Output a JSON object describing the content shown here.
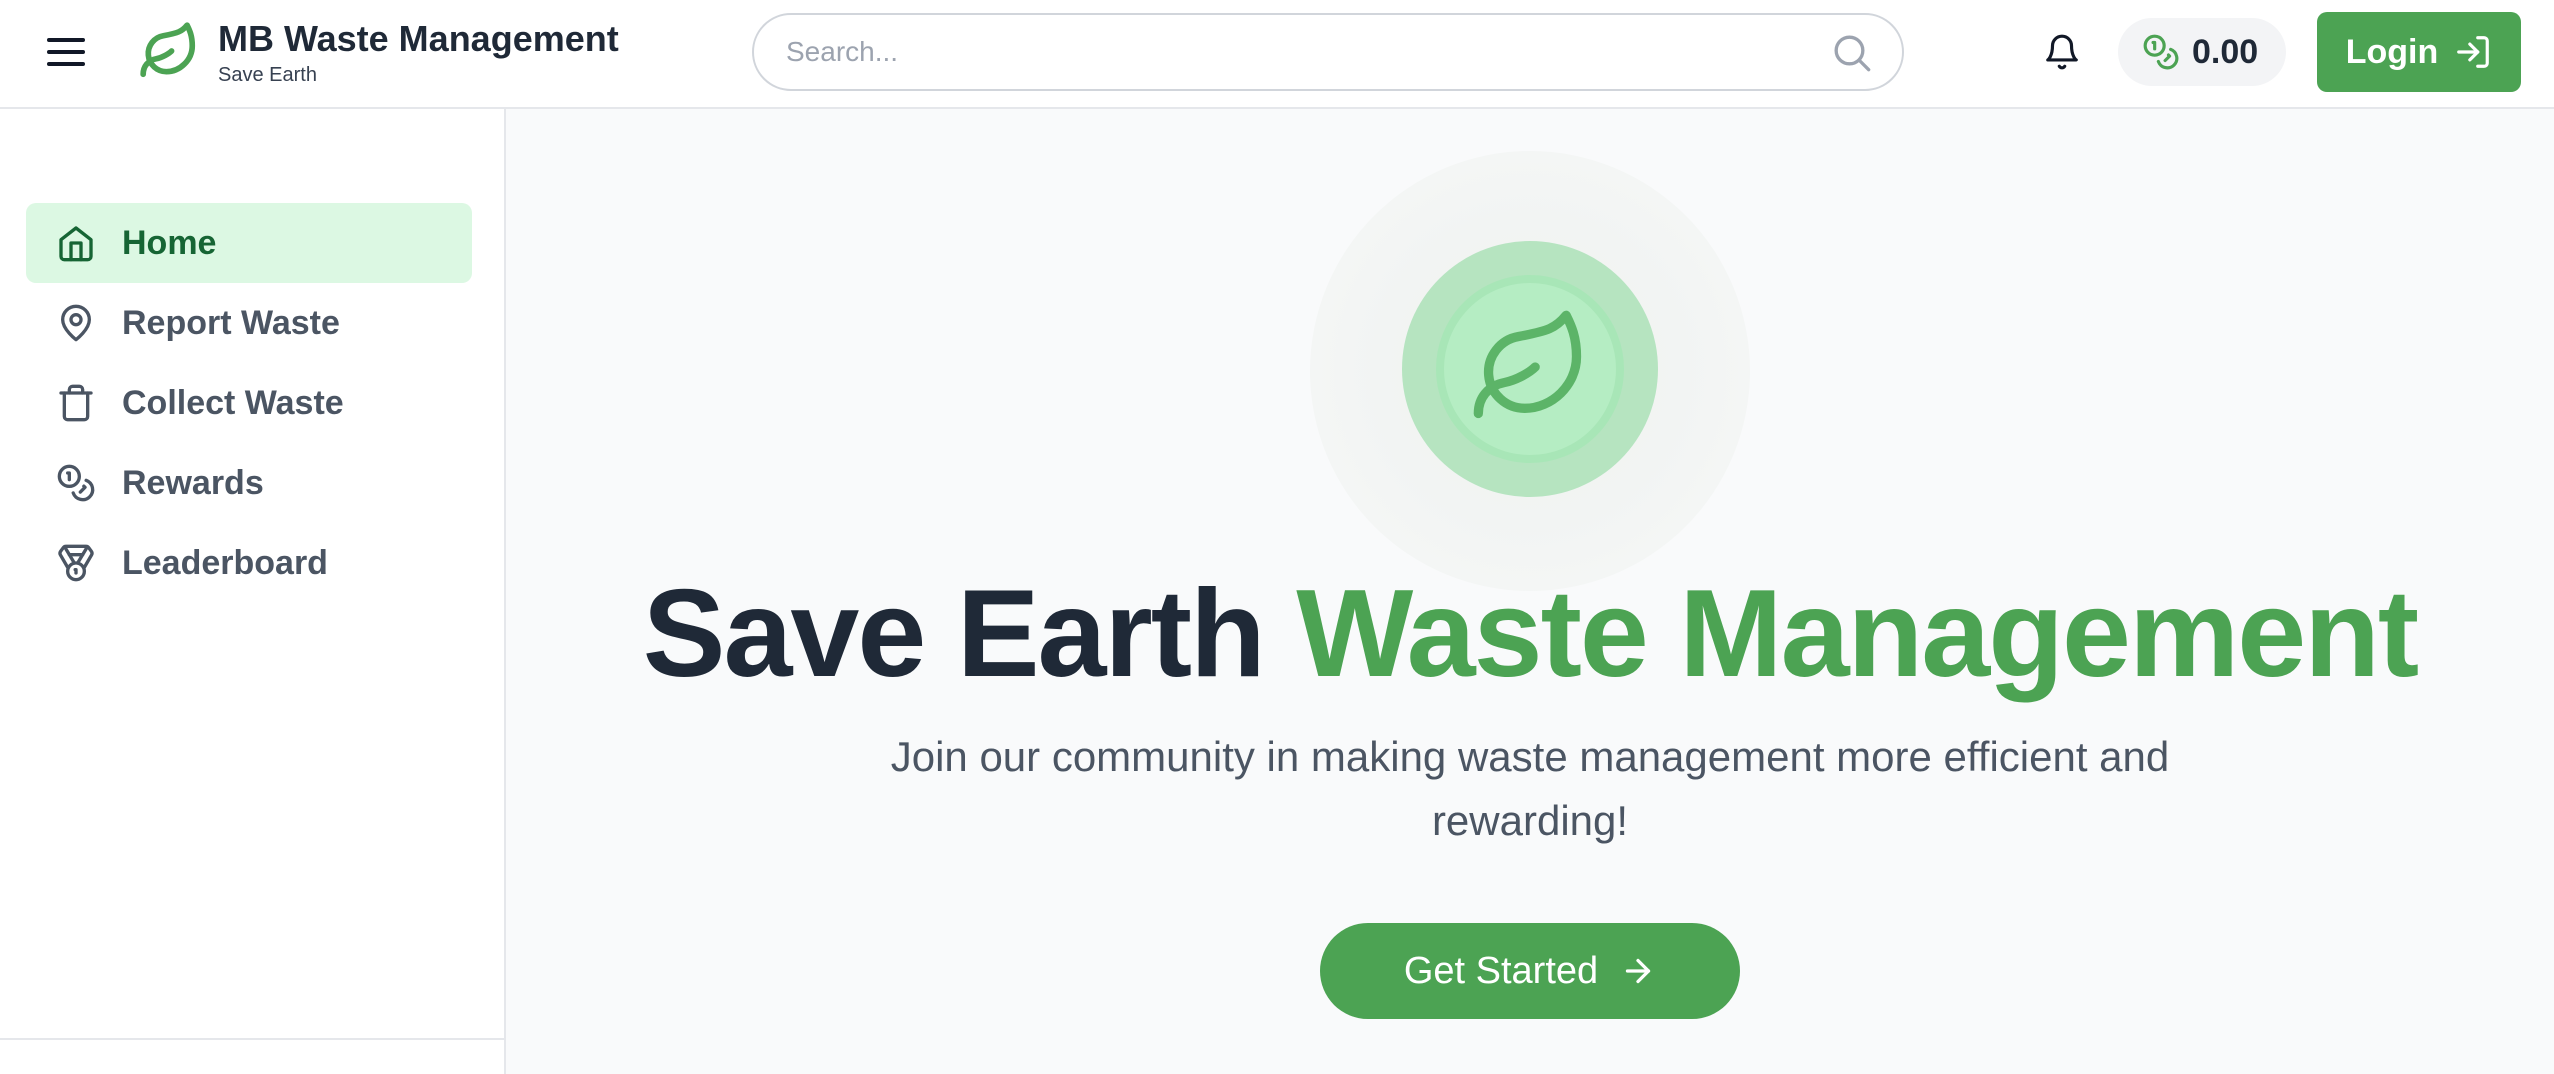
{
  "header": {
    "brand_title": "MB Waste Management",
    "brand_subtitle": "Save Earth",
    "search_placeholder": "Search...",
    "balance": "0.00",
    "login_label": "Login",
    "icons": {
      "menu": "hamburger-menu-icon",
      "logo": "leaf-icon",
      "search": "search-icon",
      "notifications": "bell-icon",
      "balance": "coins-icon",
      "login": "log-in-icon"
    }
  },
  "sidebar": {
    "items": [
      {
        "label": "Home",
        "icon": "home-icon",
        "active": true
      },
      {
        "label": "Report Waste",
        "icon": "map-pin-icon",
        "active": false
      },
      {
        "label": "Collect Waste",
        "icon": "trash-icon",
        "active": false
      },
      {
        "label": "Rewards",
        "icon": "coins-icon",
        "active": false
      },
      {
        "label": "Leaderboard",
        "icon": "medal-icon",
        "active": false
      }
    ]
  },
  "hero": {
    "title_dark": "Save Earth",
    "title_green": "Waste Management",
    "subtitle": "Join our community in making waste management more efficient and rewarding!",
    "cta_label": "Get Started",
    "icon": "leaf-icon"
  },
  "colors": {
    "brand_green": "#4ca353",
    "active_nav_bg": "#dcf8e3",
    "active_nav_text": "#166534",
    "text_dark": "#1f2937",
    "text_muted": "#4b5563"
  }
}
